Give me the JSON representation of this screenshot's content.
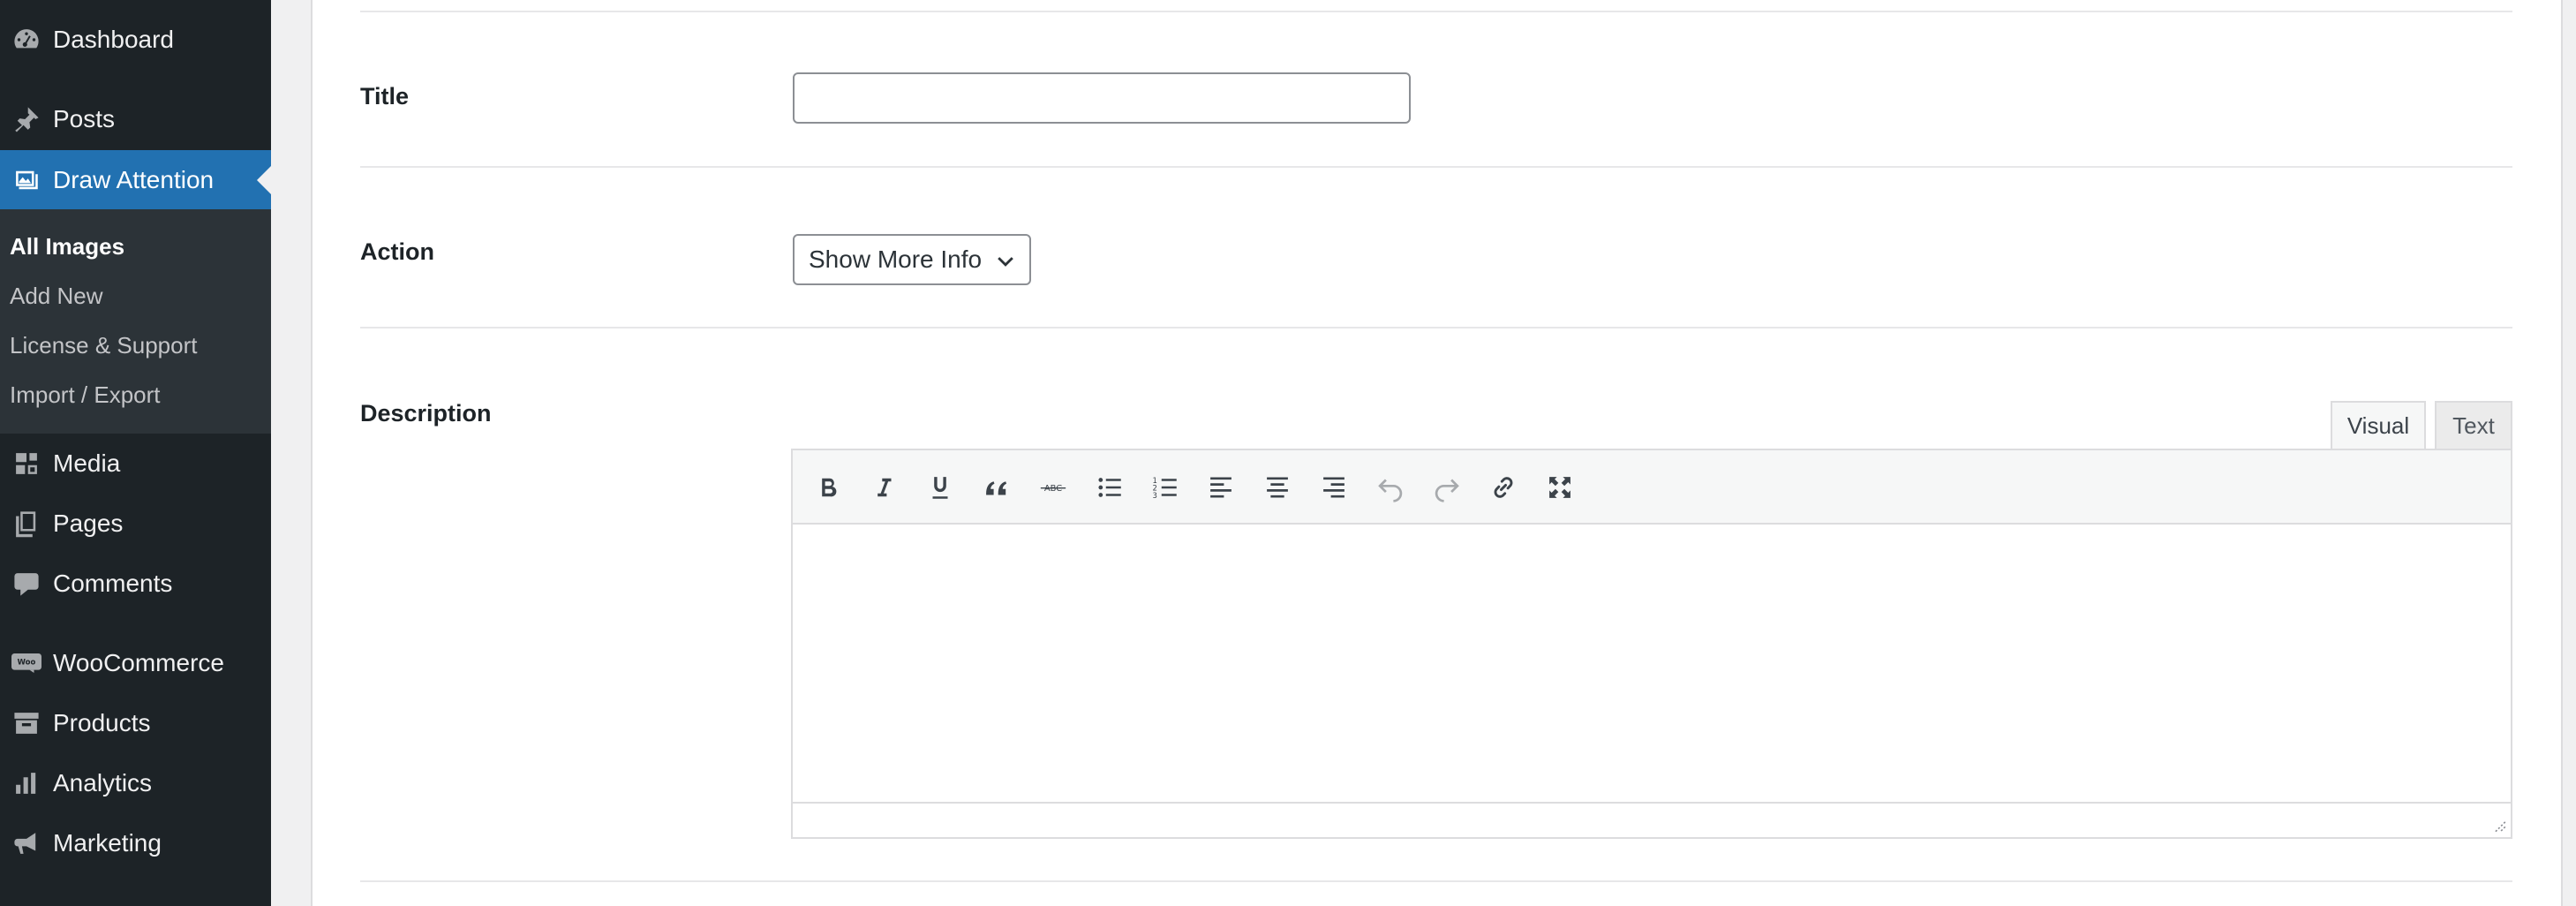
{
  "sidebar": {
    "items": [
      {
        "label": "Dashboard",
        "icon": "dashboard-icon"
      },
      {
        "label": "Posts",
        "icon": "pin-icon"
      },
      {
        "label": "Draw Attention",
        "icon": "images-icon"
      },
      {
        "label": "Media",
        "icon": "media-icon"
      },
      {
        "label": "Pages",
        "icon": "pages-icon"
      },
      {
        "label": "Comments",
        "icon": "comment-icon"
      },
      {
        "label": "WooCommerce",
        "icon": "woo-icon"
      },
      {
        "label": "Products",
        "icon": "archive-icon"
      },
      {
        "label": "Analytics",
        "icon": "bar-chart-icon"
      },
      {
        "label": "Marketing",
        "icon": "megaphone-icon"
      }
    ],
    "submenu": [
      {
        "label": "All Images"
      },
      {
        "label": "Add New"
      },
      {
        "label": "License & Support"
      },
      {
        "label": "Import / Export"
      }
    ]
  },
  "form": {
    "title_label": "Title",
    "title_value": "",
    "action_label": "Action",
    "action_selected": "Show More Info",
    "description_label": "Description"
  },
  "editor": {
    "tabs": [
      {
        "label": "Visual"
      },
      {
        "label": "Text"
      }
    ],
    "toolbar": [
      "bold-icon",
      "italic-icon",
      "underline-icon",
      "blockquote-icon",
      "strikethrough-icon",
      "bulleted-list-icon",
      "numbered-list-icon",
      "align-left-icon",
      "align-center-icon",
      "align-right-icon",
      "undo-icon",
      "redo-icon",
      "link-icon",
      "fullscreen-icon"
    ],
    "content": ""
  },
  "colors": {
    "sidebar_bg": "#1d2327",
    "submenu_bg": "#2c3338",
    "accent": "#2271b1"
  }
}
